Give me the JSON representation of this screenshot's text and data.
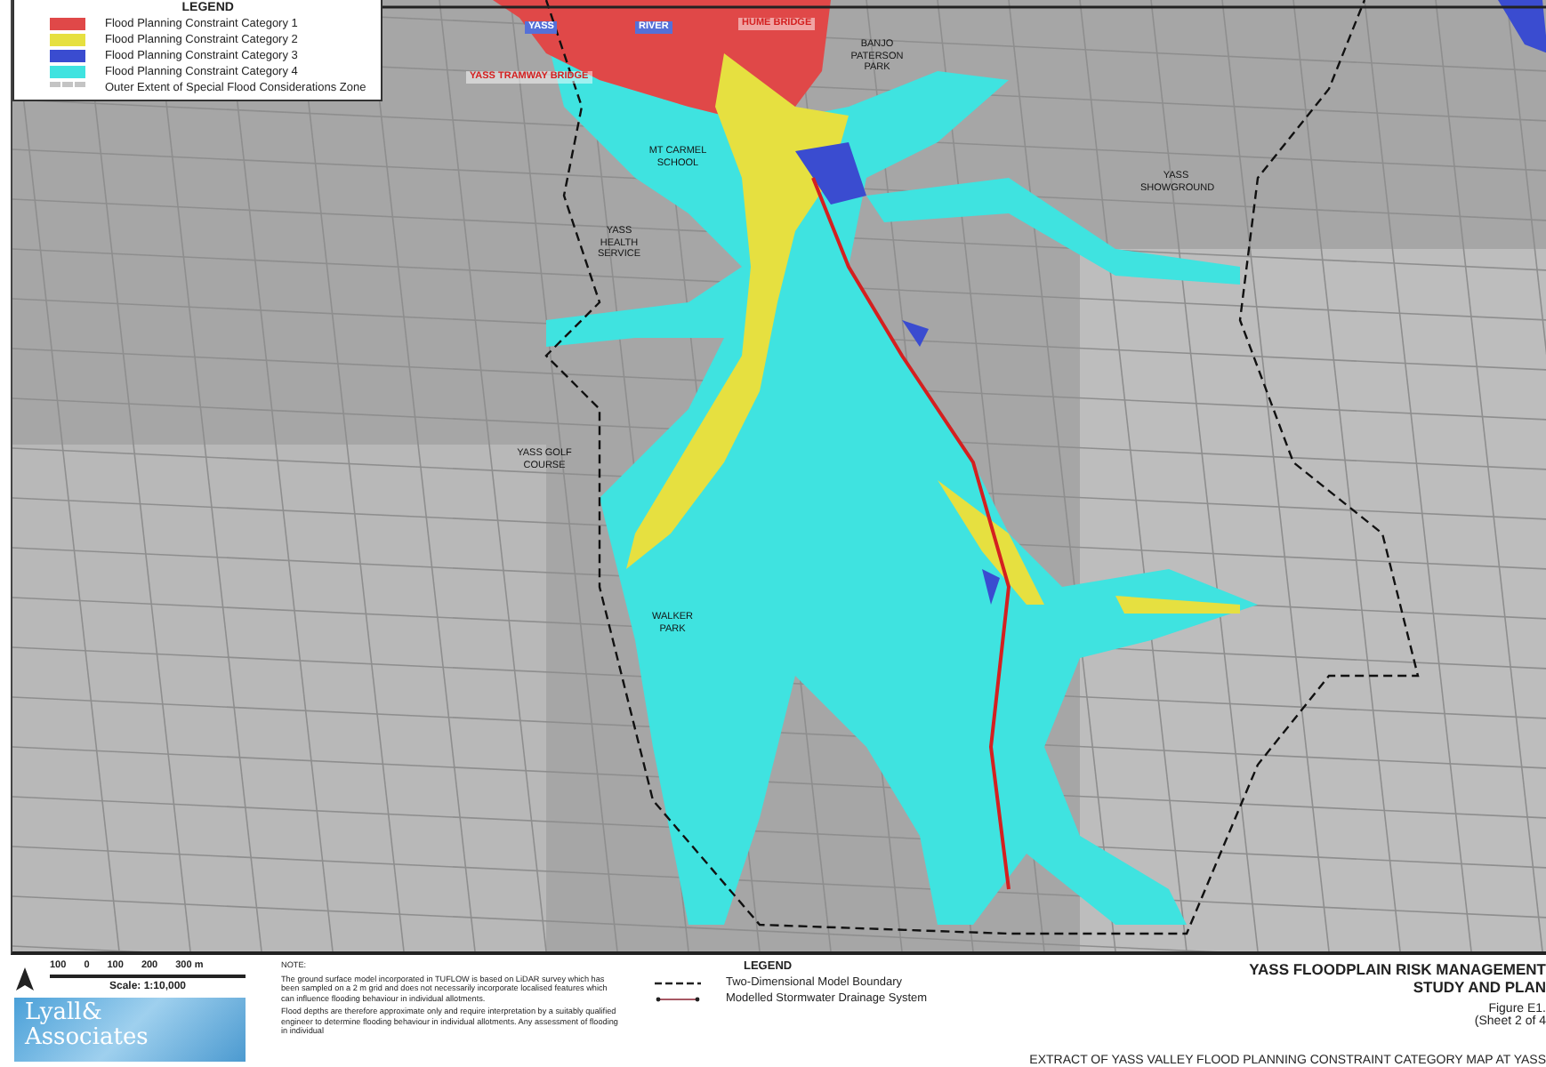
{
  "legend": {
    "title": "LEGEND",
    "items": [
      {
        "label": "Flood Planning Constraint Category 1",
        "color": "#e04848",
        "kind": "fill"
      },
      {
        "label": "Flood Planning Constraint Category 2",
        "color": "#e6e040",
        "kind": "fill"
      },
      {
        "label": "Flood Planning Constraint Category 3",
        "color": "#3a4cd0",
        "kind": "fill"
      },
      {
        "label": "Flood Planning Constraint Category 4",
        "color": "#3fe3e0",
        "kind": "fill"
      },
      {
        "label": "Outer Extent of Special Flood Considerations Zone",
        "color": "#c4c4c4",
        "kind": "dashed"
      }
    ]
  },
  "map_labels": [
    {
      "text": "YASS",
      "kind": "water"
    },
    {
      "text": "RIVER",
      "kind": "water"
    },
    {
      "text": "HUME BRIDGE",
      "kind": "bridge"
    },
    {
      "text": "YASS TRAMWAY BRIDGE",
      "kind": "bridge"
    },
    {
      "text": "BANJO PATERSON PARK",
      "kind": "place"
    },
    {
      "text": "MT CARMEL SCHOOL",
      "kind": "place"
    },
    {
      "text": "YASS SHOWGROUND",
      "kind": "place"
    },
    {
      "text": "YASS HEALTH SERVICE",
      "kind": "place"
    },
    {
      "text": "YASS GOLF COURSE",
      "kind": "place"
    },
    {
      "text": "WALKER PARK",
      "kind": "place"
    }
  ],
  "scale": {
    "ticks": [
      "100",
      "0",
      "100",
      "200",
      "300 m"
    ],
    "caption": "Scale: 1:10,000"
  },
  "logo": {
    "lines": [
      "Lyall&",
      "Associates"
    ]
  },
  "note": {
    "heading": "NOTE:",
    "paragraphs": [
      "The ground surface model incorporated in TUFLOW is based on LiDAR survey which has been sampled on a 2 m grid and does not necessarily incorporate localised features which can influence flooding behaviour in individual allotments.",
      "Flood depths are therefore approximate only and require interpretation by a suitably qualified engineer to determine flooding behaviour in individual allotments. Any assessment of flooding in individual"
    ]
  },
  "legend_2": {
    "title": "LEGEND",
    "items": [
      {
        "label": "Two-Dimensional Model Boundary",
        "kind": "dashed"
      },
      {
        "label": "Modelled Stormwater Drainage System",
        "kind": "drainage"
      }
    ]
  },
  "title_block": {
    "title_lines": [
      "YASS FLOODPLAIN RISK MANAGEMENT",
      "STUDY AND PLAN"
    ],
    "figure": "Figure E1.",
    "sheet": "(Sheet 2 of 4",
    "caption": "EXTRACT OF YASS VALLEY FLOOD PLANNING CONSTRAINT CATEGORY MAP AT YASS"
  }
}
